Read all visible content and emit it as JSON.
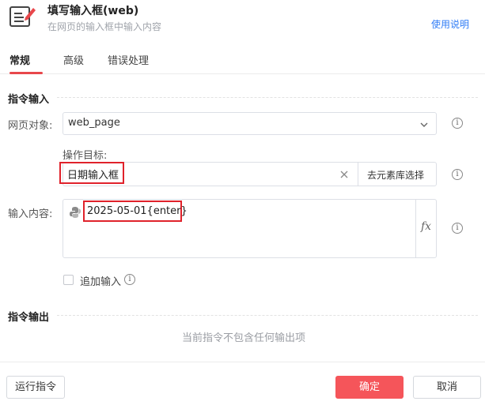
{
  "header": {
    "title": "填写输入框(web)",
    "subtitle": "在网页的输入框中输入内容",
    "help_link": "使用说明",
    "icon": "edit-form-icon"
  },
  "tabs": [
    {
      "label": "常规",
      "active": true
    },
    {
      "label": "高级",
      "active": false
    },
    {
      "label": "错误处理",
      "active": false
    }
  ],
  "input_section": {
    "title": "指令输入",
    "web_object": {
      "label": "网页对象:",
      "value": "web_page"
    },
    "target": {
      "label": "操作目标:",
      "value": "日期输入框",
      "select_button": "去元素库选择"
    },
    "content": {
      "label": "输入内容:",
      "value": "2025-05-01{enter}",
      "fx": "fx"
    },
    "append": {
      "label": "追加输入",
      "checked": false
    }
  },
  "output_section": {
    "title": "指令输出",
    "empty_text": "当前指令不包含任何输出项"
  },
  "footer": {
    "run_button": "运行指令",
    "confirm_button": "确定",
    "cancel_button": "取消"
  },
  "colors": {
    "accent": "#e8474b",
    "link": "#2f7cf6",
    "confirm_bg": "#f5555a",
    "highlight": "#e0222b"
  }
}
